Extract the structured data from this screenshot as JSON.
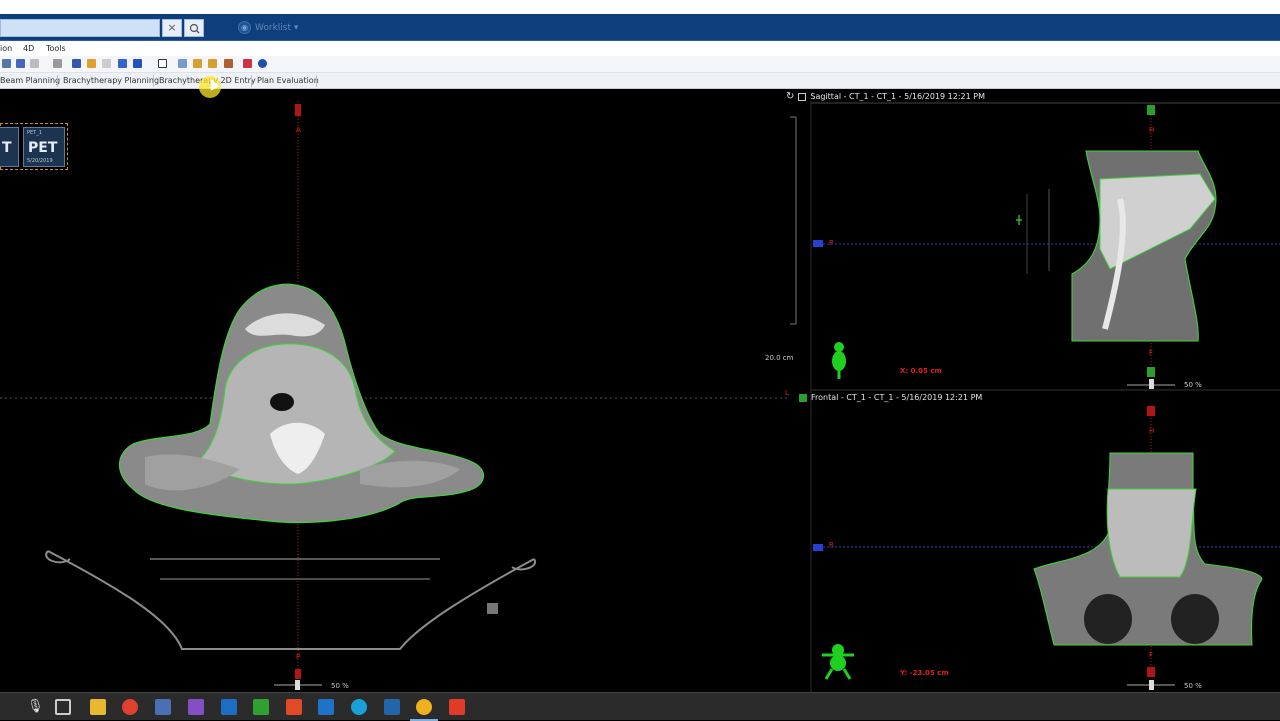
{
  "search": {
    "clear_label": "×"
  },
  "worklist": {
    "label": "Worklist ▾",
    "icon": "worklist-icon"
  },
  "menu": {
    "items": [
      "ion",
      "4D",
      "Tools"
    ]
  },
  "tabs": {
    "items": [
      "Beam Planning",
      "Brachytherapy Planning",
      "Brachytherapy 2D Entry",
      "Plan Evaluation"
    ]
  },
  "thumbs": {
    "ct": {
      "series": "",
      "modality": "T",
      "date": ""
    },
    "pet": {
      "series": "PET_1",
      "modality": "PET",
      "date": "5/20/2019"
    }
  },
  "axial": {
    "top_marker": "A",
    "bottom_marker": "P",
    "scale_label": "20.0 cm",
    "right_marker": "L",
    "zoom": "50 %"
  },
  "sagittal": {
    "title": "Sagittal - CT_1 - CT_1 - 5/16/2019 12:21 PM",
    "top_marker": "H",
    "left_marker": "P",
    "bottom_marker": "F",
    "coord": "X: 0.05 cm",
    "zoom": "50 %"
  },
  "frontal": {
    "title": "Frontal - CT_1 - CT_1 - 5/16/2019 12:21 PM",
    "top_marker": "H",
    "left_marker": "R",
    "bottom_marker": "F",
    "coord": "Y: -23.05 cm",
    "zoom": "50 %"
  },
  "colors": {
    "title_bar": "#0e3f7c",
    "contour": "#3fd23a",
    "crosshair_red": "#d01e1e",
    "marker_blue": "#2a3fd0"
  },
  "taskbar_icons": [
    "microphone-icon",
    "task-view-icon",
    "file-explorer-icon",
    "chrome-icon",
    "visual-studio-code-icon",
    "visual-studio-icon",
    "outlook-icon",
    "camtasia-icon",
    "recorder-icon",
    "sharepoint-icon",
    "skype-icon",
    "terminal-icon",
    "app-icon",
    "camtasia-recorder-icon"
  ]
}
